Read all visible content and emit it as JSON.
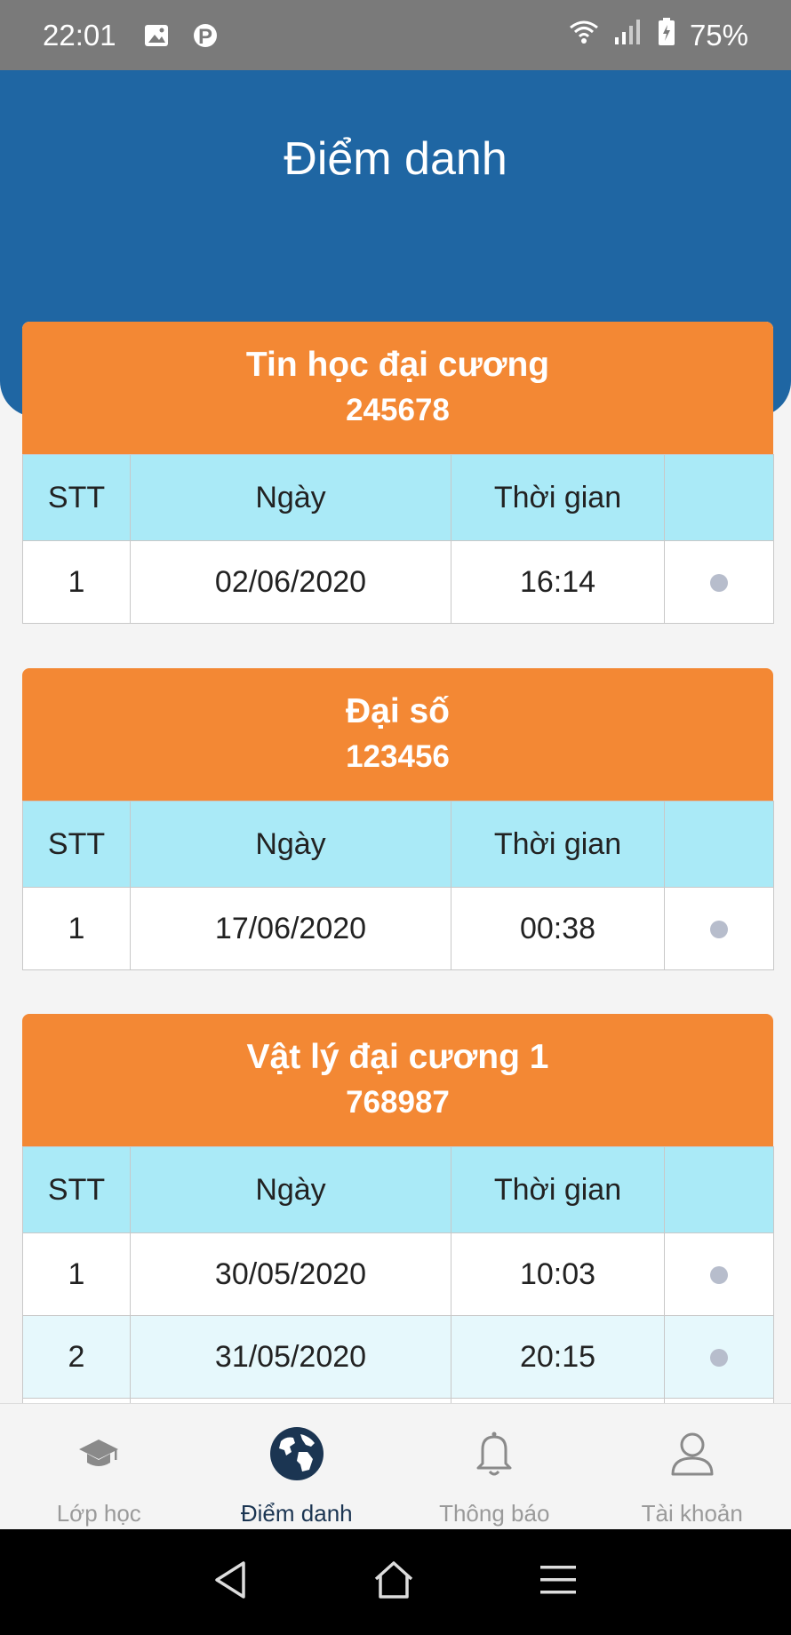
{
  "status_bar": {
    "time": "22:01",
    "battery": "75%"
  },
  "header": {
    "title": "Điểm danh"
  },
  "columns": [
    "STT",
    "Ngày",
    "Thời gian",
    ""
  ],
  "courses": [
    {
      "name": "Tin học đại cương",
      "code": "245678",
      "rows": [
        {
          "stt": "1",
          "date": "02/06/2020",
          "time": "16:14"
        }
      ]
    },
    {
      "name": "Đại số",
      "code": "123456",
      "rows": [
        {
          "stt": "1",
          "date": "17/06/2020",
          "time": "00:38"
        }
      ]
    },
    {
      "name": "Vật lý đại cương 1",
      "code": "768987",
      "rows": [
        {
          "stt": "1",
          "date": "30/05/2020",
          "time": "10:03"
        },
        {
          "stt": "2",
          "date": "31/05/2020",
          "time": "20:15"
        }
      ]
    }
  ],
  "tabs": [
    {
      "label": "Lớp học",
      "icon": "graduation-cap-icon"
    },
    {
      "label": "Điểm danh",
      "icon": "globe-icon",
      "active": true
    },
    {
      "label": "Thông báo",
      "icon": "bell-icon"
    },
    {
      "label": "Tài khoản",
      "icon": "user-icon"
    }
  ],
  "colors": {
    "header": "#1f66a3",
    "card_head": "#f38834",
    "table_head": "#aaeaf7",
    "active_tab": "#1b3552"
  }
}
